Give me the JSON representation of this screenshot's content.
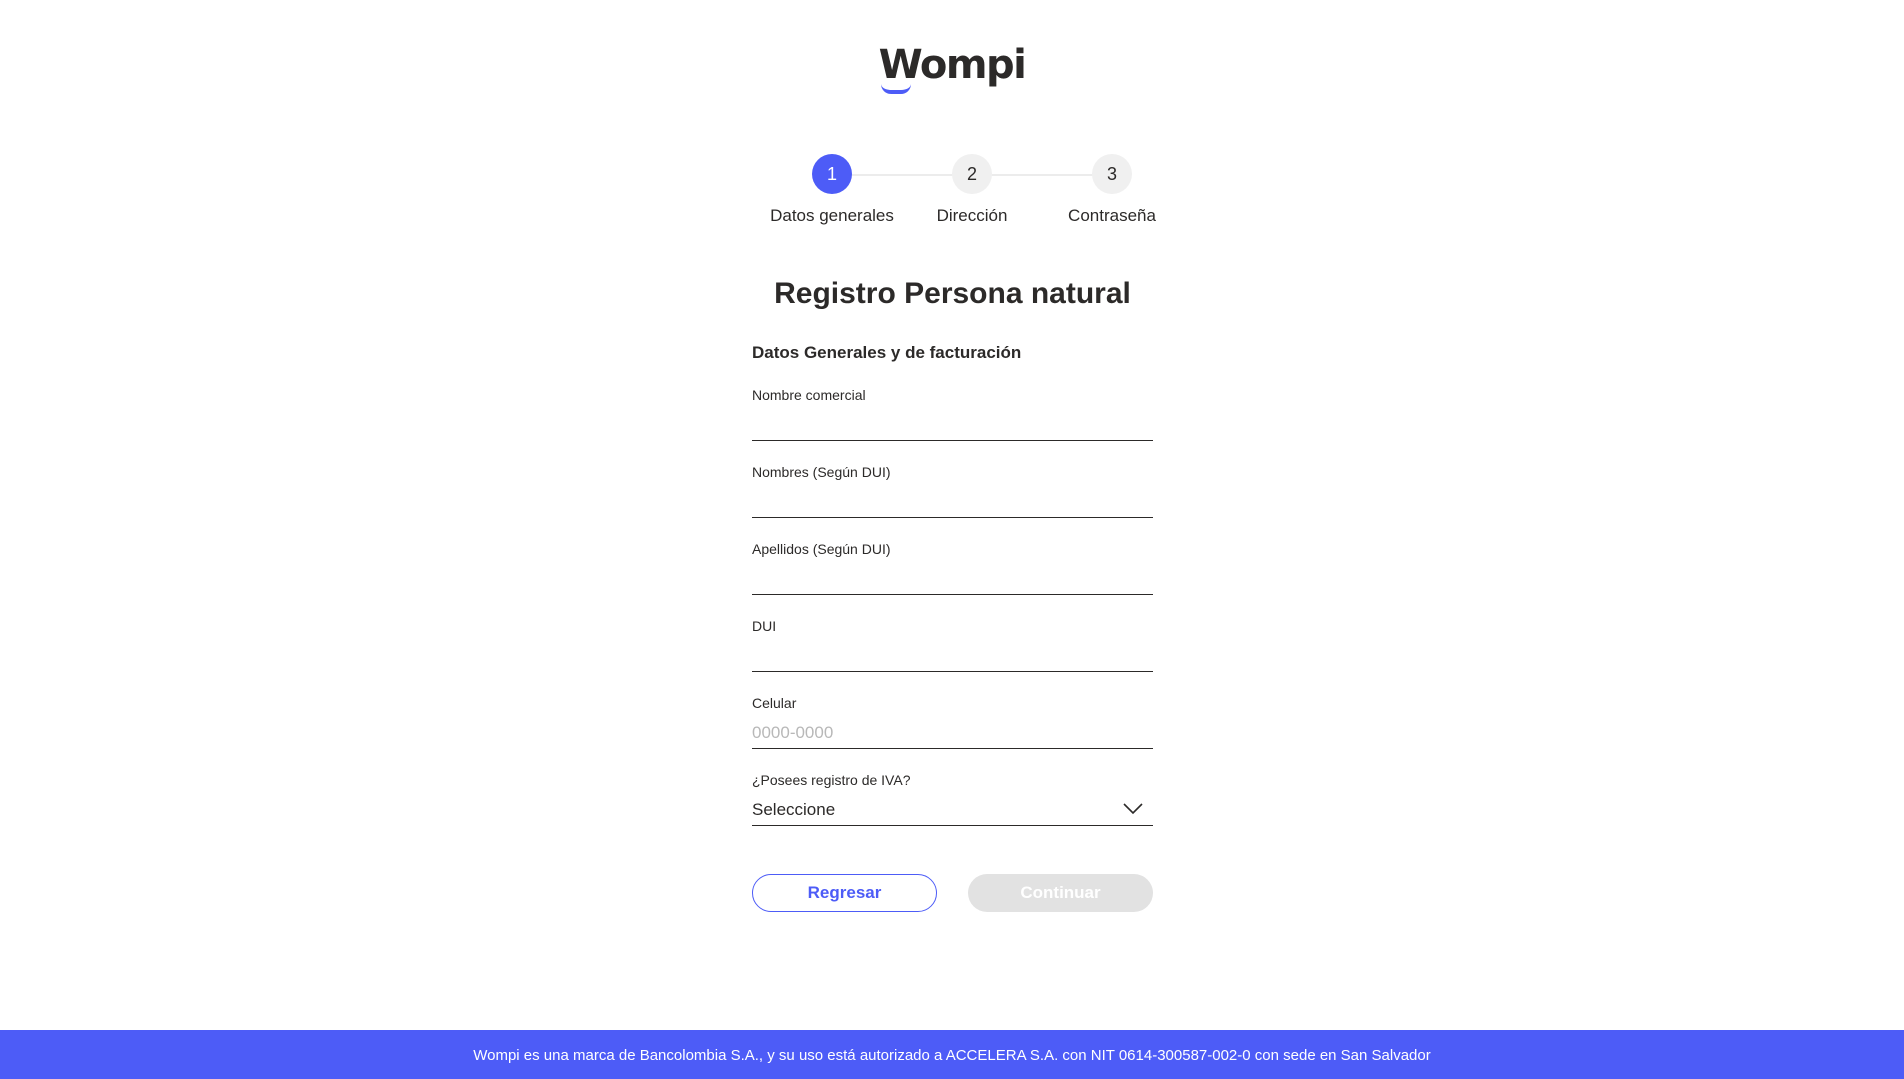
{
  "brand": {
    "logo_text": "Wompi",
    "accent_color": "#4d5cf7"
  },
  "stepper": {
    "steps": [
      {
        "number": "1",
        "label": "Datos generales",
        "active": true
      },
      {
        "number": "2",
        "label": "Dirección",
        "active": false
      },
      {
        "number": "3",
        "label": "Contraseña",
        "active": false
      }
    ]
  },
  "form": {
    "title": "Registro Persona natural",
    "subtitle": "Datos Generales y de facturación",
    "fields": {
      "nombre_comercial": {
        "label": "Nombre comercial",
        "value": "",
        "placeholder": ""
      },
      "nombres": {
        "label": "Nombres (Según DUI)",
        "value": "",
        "placeholder": ""
      },
      "apellidos": {
        "label": "Apellidos (Según DUI)",
        "value": "",
        "placeholder": ""
      },
      "dui": {
        "label": "DUI",
        "value": "",
        "placeholder": ""
      },
      "celular": {
        "label": "Celular",
        "value": "",
        "placeholder": "0000-0000"
      },
      "iva": {
        "label": "¿Posees registro de IVA?",
        "selected": "Seleccione",
        "icon": "chevron-down-icon"
      }
    },
    "buttons": {
      "back_label": "Regresar",
      "continue_label": "Continuar"
    }
  },
  "footer": {
    "text": "Wompi es una marca de Bancolombia S.A., y su uso está autorizado a ACCELERA S.A. con NIT 0614-300587-002-0 con sede en San Salvador"
  }
}
